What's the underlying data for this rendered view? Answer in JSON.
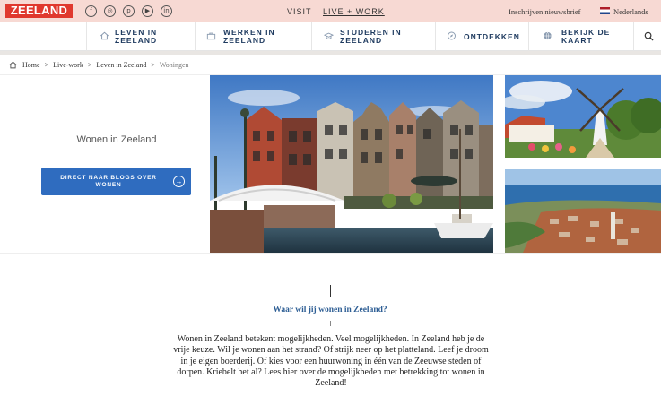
{
  "topbar": {
    "logo": "ZEELAND",
    "social": [
      {
        "icon": "facebook-icon",
        "glyph": "f"
      },
      {
        "icon": "instagram-icon",
        "glyph": "◎"
      },
      {
        "icon": "pinterest-icon",
        "glyph": "p"
      },
      {
        "icon": "youtube-icon",
        "glyph": "▶"
      },
      {
        "icon": "linkedin-icon",
        "glyph": "in"
      }
    ],
    "nav": [
      {
        "label": "VISIT",
        "active": false
      },
      {
        "label": "LIVE + WORK",
        "active": true
      }
    ],
    "newsletter": "Inschrijven nieuwsbrief",
    "language": "Nederlands",
    "colors": {
      "bar": "#f7d9d3",
      "logo": "#e0382e"
    }
  },
  "mainnav": {
    "items": [
      {
        "icon": "house-icon",
        "line1": "LEVEN IN",
        "line2": "ZEELAND"
      },
      {
        "icon": "briefcase-icon",
        "line1": "WERKEN IN",
        "line2": "ZEELAND"
      },
      {
        "icon": "graduation-cap-icon",
        "line1": "STUDEREN IN",
        "line2": "ZEELAND"
      },
      {
        "icon": "compass-icon",
        "line1": "ONTDEKKEN",
        "line2": ""
      },
      {
        "icon": "globe-icon",
        "line1": "BEKIJK DE",
        "line2": "KAART"
      }
    ],
    "search_icon": "search-icon",
    "color": "#1e3a5f"
  },
  "breadcrumb": {
    "items": [
      "Home",
      "Live-work",
      "Leven in Zeeland"
    ],
    "current": "Woningen"
  },
  "hero": {
    "title": "Wonen in Zeeland",
    "button_label": "DIRECT NAAR BLOGS OVER WONEN",
    "button_color": "#2f6cbf"
  },
  "content": {
    "subheading": "Waar wil jij wonen in Zeeland?",
    "body": "Wonen in Zeeland betekent mogelijkheden. Veel mogelijkheden. In Zeeland heb je de vrije keuze. Wil je wonen aan het strand? Of strijk neer op het platteland. Leef je droom in je eigen boerderij. Of kies voor een huurwoning in één van de Zeeuwse steden of dorpen. Kriebelt het al? Lees hier over de mogelijkheden met betrekking tot wonen in Zeeland!"
  }
}
